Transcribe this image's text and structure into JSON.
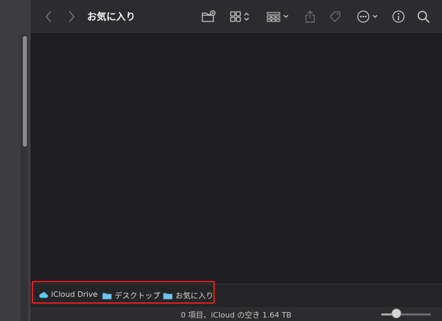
{
  "window": {
    "title": "お気に入り"
  },
  "toolbar": {
    "icons": [
      "back-icon",
      "forward-icon",
      "new-folder-icon",
      "icon-view-icon",
      "group-icon",
      "share-icon",
      "tag-icon",
      "more-actions-icon",
      "info-icon",
      "search-icon"
    ],
    "accent_color": "#5ac8fa"
  },
  "pathbar": {
    "items": [
      {
        "label": "iCloud Drive",
        "icon": "icloud-icon"
      },
      {
        "label": "デスクトップ",
        "icon": "folder-icon"
      },
      {
        "label": "お気に入り",
        "icon": "folder-icon"
      }
    ],
    "separator": "›",
    "highlight_color": "#e41e1e"
  },
  "status": {
    "text": "0 項目、iCloud の空き 1.64 TB",
    "zoom_level": 0.3
  }
}
